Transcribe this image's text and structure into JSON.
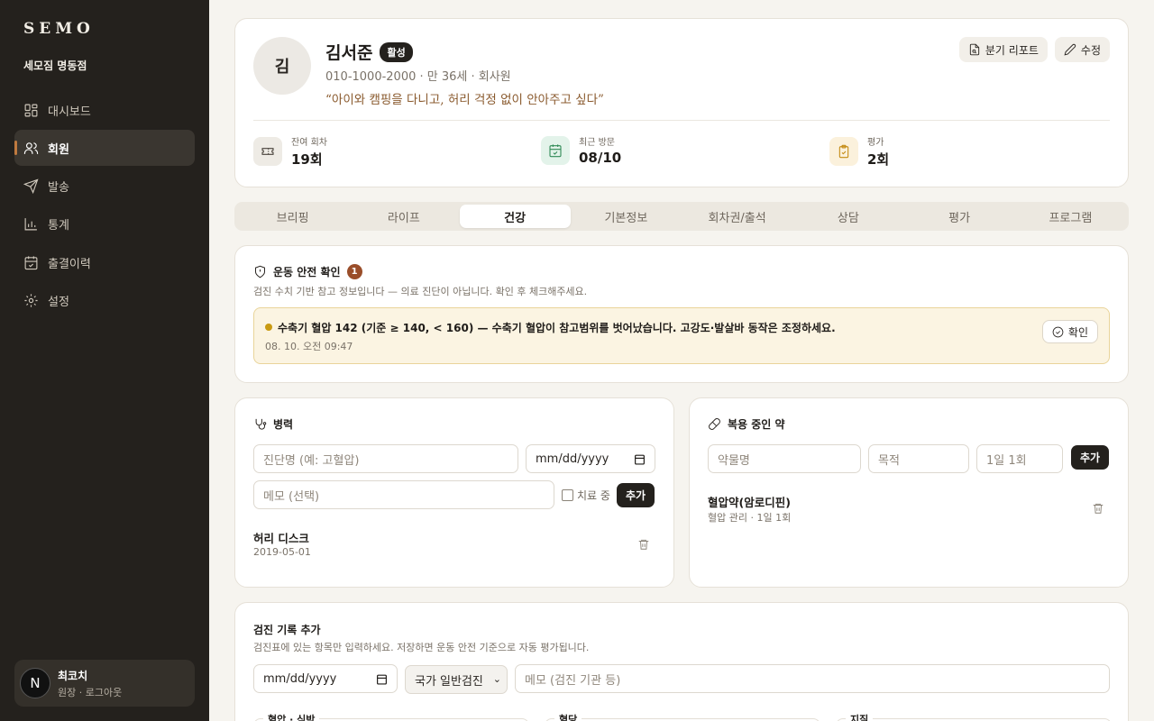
{
  "sidebar": {
    "brand": "SEMO",
    "store": "세모짐 명동점",
    "items": [
      {
        "label": "대시보드",
        "icon": "dashboard-icon"
      },
      {
        "label": "회원",
        "icon": "members-icon",
        "active": true
      },
      {
        "label": "발송",
        "icon": "send-icon"
      },
      {
        "label": "통계",
        "icon": "stats-icon"
      },
      {
        "label": "출결이력",
        "icon": "calendar-check-icon"
      },
      {
        "label": "설정",
        "icon": "gear-icon"
      }
    ],
    "user": {
      "initial": "N",
      "name": "최코치",
      "role": "원장 · 로그아웃"
    }
  },
  "profile": {
    "avatar": "김",
    "name": "김서준",
    "status": "활성",
    "sub": "010-1000-2000 · 만 36세 · 회사원",
    "quote": "“아이와 캠핑을 다니고, 허리 걱정 없이 안아주고 싶다”",
    "actions": {
      "report": "분기 리포트",
      "edit": "수정"
    },
    "stats": [
      {
        "label": "잔여 회차",
        "value": "19회"
      },
      {
        "label": "최근 방문",
        "value": "08/10"
      },
      {
        "label": "평가",
        "value": "2회"
      }
    ]
  },
  "tabs": [
    "브리핑",
    "라이프",
    "건강",
    "기본정보",
    "회차권/출석",
    "상담",
    "평가",
    "프로그램"
  ],
  "active_tab": "건강",
  "safety": {
    "title": "운동 안전 확인",
    "count": "1",
    "desc": "검진 수치 기반 참고 정보입니다 — 의료 진단이 아닙니다. 확인 후 체크해주세요.",
    "alert": {
      "text": "수축기 혈압 142 (기준 ≥ 140, < 160) — 수축기 혈압이 참고범위를 벗어났습니다. 고강도·발살바 동작은 조정하세요.",
      "time": "08. 10. 오전 09:47",
      "confirm": "확인"
    }
  },
  "history": {
    "title": "병력",
    "diag_placeholder": "진단명 (예: 고혈압)",
    "date_placeholder": "mm/dd/yyyy",
    "memo_placeholder": "메모 (선택)",
    "treating_label": "치료 중",
    "add": "추가",
    "items": [
      {
        "name": "허리 디스크",
        "date": "2019-05-01"
      }
    ]
  },
  "meds": {
    "title": "복용 중인 약",
    "name_placeholder": "약물명",
    "purpose_placeholder": "목적",
    "dose_placeholder": "1일 1회",
    "add": "추가",
    "items": [
      {
        "name": "혈압약(암로디핀)",
        "sub": "혈압 관리 · 1일 1회"
      }
    ]
  },
  "checkup": {
    "title": "검진 기록 추가",
    "desc": "검진표에 있는 항목만 입력하세요. 저장하면 운동 안전 기준으로 자동 평가됩니다.",
    "date_placeholder": "mm/dd/yyyy",
    "type": "국가 일반검진",
    "memo_placeholder": "메모 (검진 기관 등)",
    "groups": [
      "혈압 · 심박",
      "혈당",
      "지질"
    ]
  },
  "colors": {
    "accent": "#c07a3f",
    "sidebar": "#24211d",
    "alert_bg": "#fbf4e2"
  }
}
